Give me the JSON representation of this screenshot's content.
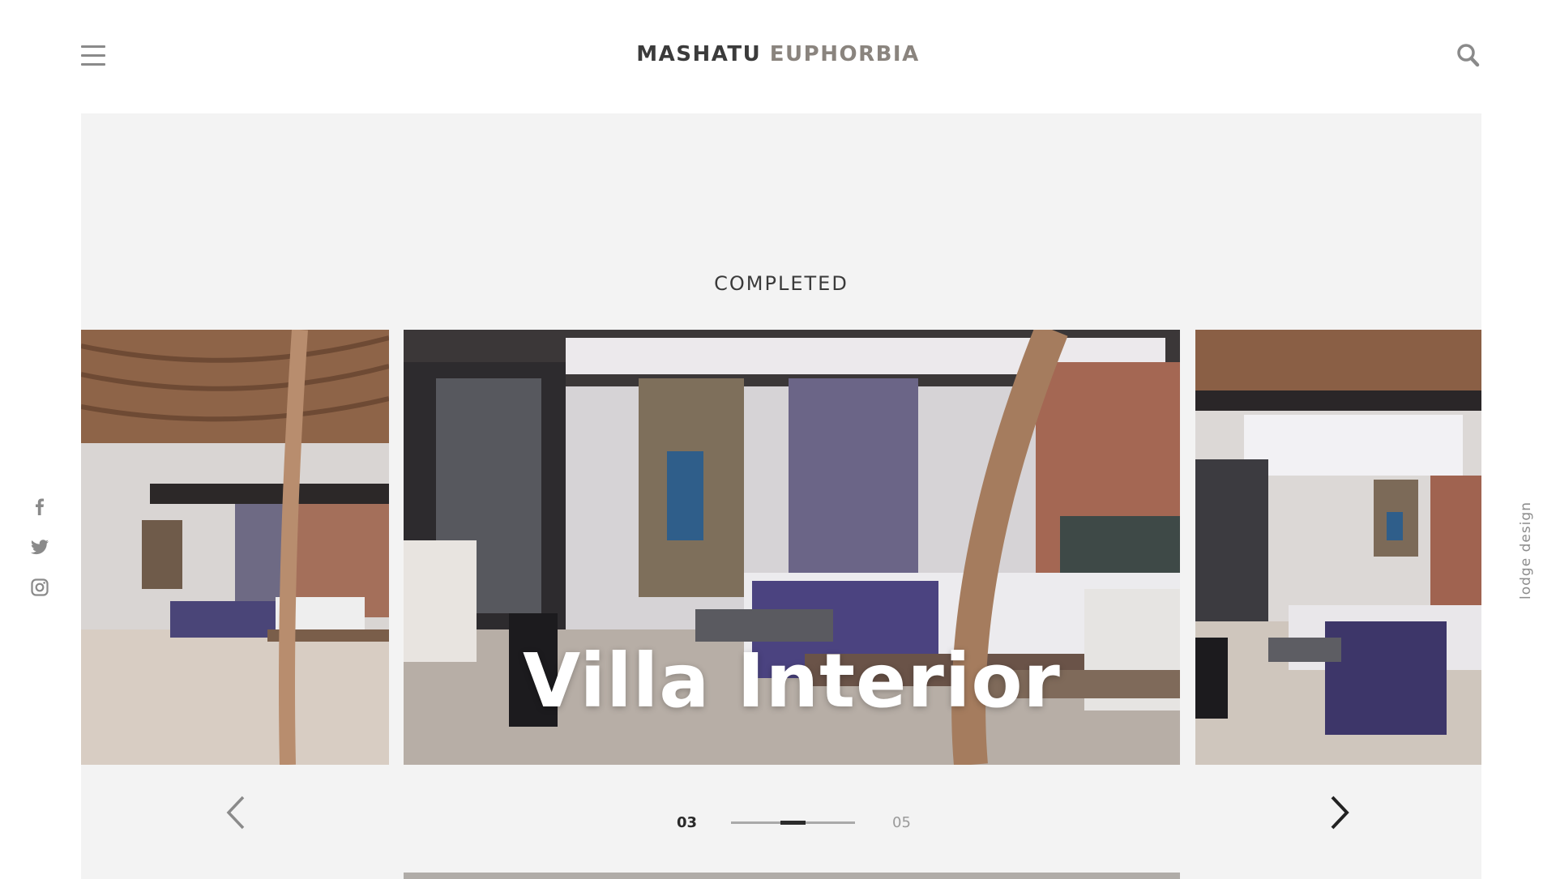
{
  "header": {
    "logo_primary": "MASHATU",
    "logo_secondary": "EUPHORBIA",
    "menu_icon": "hamburger-menu-icon",
    "search_icon": "search-icon"
  },
  "social": [
    {
      "icon": "facebook-icon"
    },
    {
      "icon": "twitter-icon"
    },
    {
      "icon": "instagram-icon"
    }
  ],
  "side_label": "lodge design",
  "gallery": {
    "status": "COMPLETED",
    "current_slide_title": "Villa Interior",
    "pager": {
      "current": "03",
      "total": "05",
      "progress_fraction": 0.6
    }
  },
  "colors": {
    "accent_gray": "#8a847e",
    "stage_bg": "#f3f3f3",
    "text_dark": "#2a2a2a"
  }
}
